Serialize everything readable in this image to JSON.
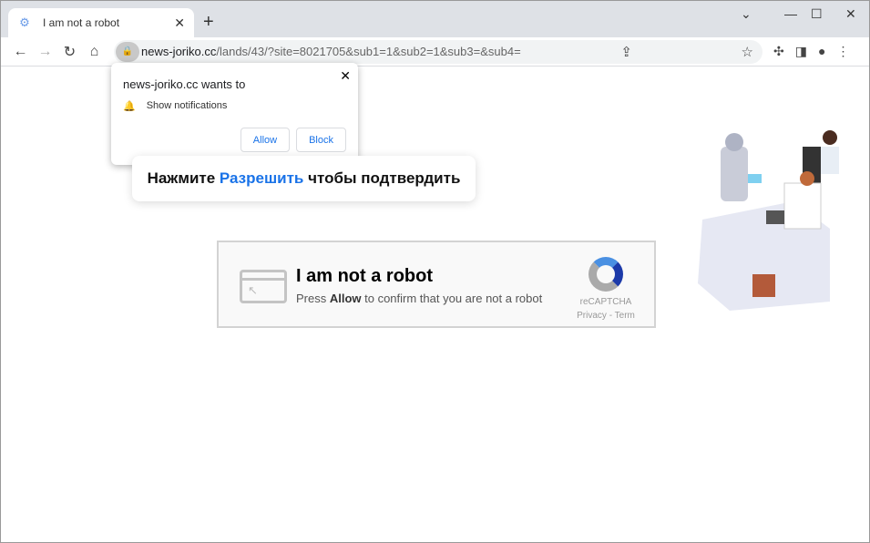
{
  "browser": {
    "tab_title": "I am not a robot",
    "url_host": "news-joriko.cc",
    "url_path": "/lands/43/?site=8021705&sub1=1&sub2=1&sub3=&sub4="
  },
  "popup": {
    "title": "news-joriko.cc wants to",
    "permission": "Show notifications",
    "allow": "Allow",
    "block": "Block"
  },
  "hint": {
    "before": "Нажмите ",
    "highlight": "Разрешить",
    "after": " чтобы подтвердить"
  },
  "captcha": {
    "title": "I am not a robot",
    "press": "Press ",
    "allow": "Allow",
    "rest": " to confirm that you are not a robot",
    "brand": "reCAPTCHA",
    "links": "Privacy - Term"
  },
  "colors": {
    "accent": "#1a73e8"
  }
}
